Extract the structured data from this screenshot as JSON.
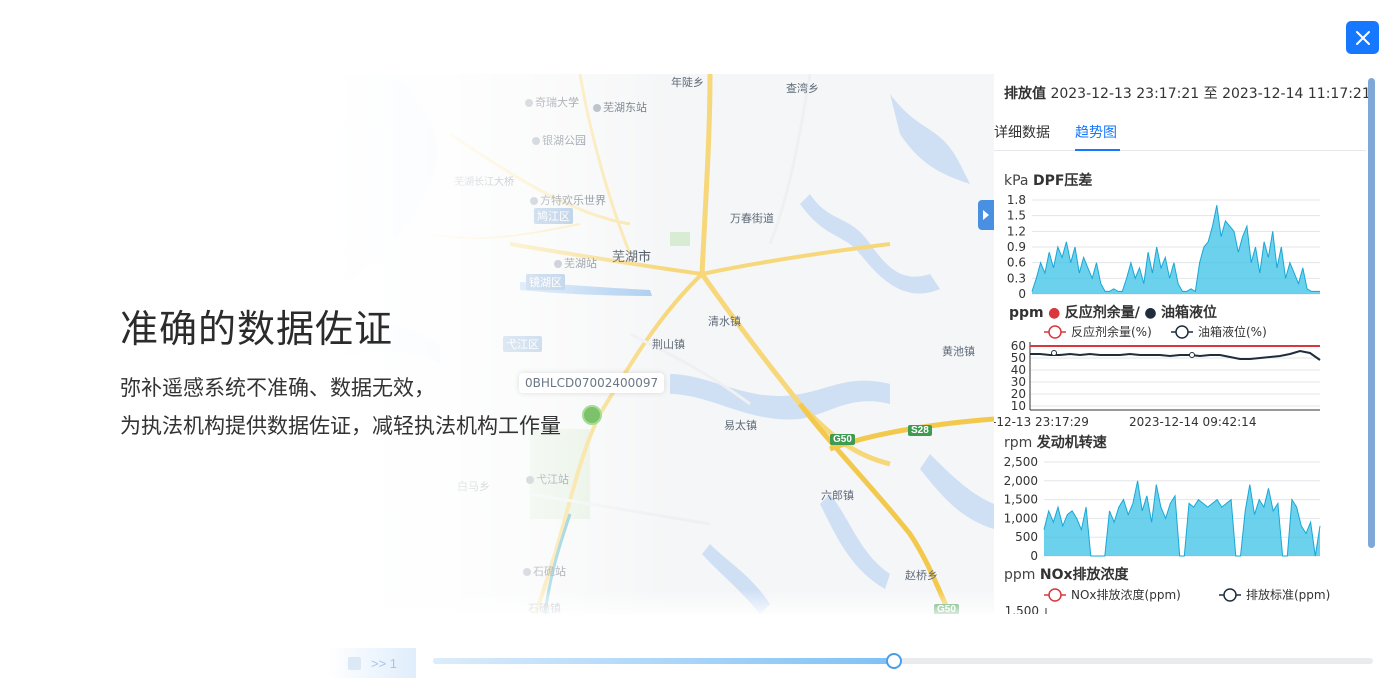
{
  "hero": {
    "title": "准确的数据佐证",
    "line1": "弥补遥感系统不准确、数据无效，",
    "line2": "为执法机构提供数据佐证，减轻执法机构工作量"
  },
  "map": {
    "vehicle_id": "0BHLCD07002400097",
    "labels": [
      {
        "text": "年陡乡",
        "cls": ""
      },
      {
        "text": "查湾乡",
        "cls": ""
      },
      {
        "text": "奇瑞大学",
        "cls": "poi"
      },
      {
        "text": "芜湖东站",
        "cls": "poi"
      },
      {
        "text": "银湖公园",
        "cls": "poi"
      },
      {
        "text": "芜湖长江大桥",
        "cls": ""
      },
      {
        "text": "方特欢乐世界",
        "cls": "poi"
      },
      {
        "text": "万春街道",
        "cls": ""
      },
      {
        "text": "芜湖市",
        "cls": "big"
      },
      {
        "text": "芜湖站",
        "cls": "poi"
      },
      {
        "text": "清水镇",
        "cls": ""
      },
      {
        "text": "荆山镇",
        "cls": ""
      },
      {
        "text": "黄池镇",
        "cls": ""
      },
      {
        "text": "易太镇",
        "cls": ""
      },
      {
        "text": "白马乡",
        "cls": ""
      },
      {
        "text": "弋江站",
        "cls": "poi"
      },
      {
        "text": "六郎镇",
        "cls": ""
      },
      {
        "text": "石硊站",
        "cls": "poi"
      },
      {
        "text": "石硊镇",
        "cls": ""
      },
      {
        "text": "赵桥乡",
        "cls": ""
      }
    ],
    "districts": [
      "鸠江区",
      "镜湖区",
      "弋江区"
    ],
    "roads": [
      "G50",
      "S28",
      "G50"
    ]
  },
  "panel": {
    "head_label": "排放值",
    "head_range_start": "2023-12-13 23:17:21",
    "head_range_sep": "至",
    "head_range_end": "2023-12-14 11:17:21",
    "tabs": [
      "详细数据",
      "趋势图"
    ]
  },
  "chart_data": [
    {
      "type": "area",
      "unit": "kPa",
      "title": "DPF压差",
      "ylim": [
        0,
        1.8
      ],
      "yticks": [
        "1.8",
        "1.5",
        "1.2",
        "0.9",
        "0.6",
        "0.3",
        "0"
      ],
      "color": "#39c1e6",
      "values": [
        0.05,
        0.3,
        0.6,
        0.4,
        0.8,
        0.5,
        0.9,
        0.7,
        1.0,
        0.6,
        0.9,
        0.4,
        0.7,
        0.5,
        0.3,
        0.6,
        0.2,
        0.05,
        0.05,
        0.1,
        0.05,
        0.05,
        0.3,
        0.6,
        0.3,
        0.5,
        0.2,
        0.8,
        0.4,
        0.9,
        0.5,
        0.7,
        0.3,
        0.6,
        0.2,
        0.05,
        0.05,
        0.1,
        0.05,
        0.6,
        0.9,
        1.0,
        1.3,
        1.7,
        1.1,
        1.4,
        1.3,
        1.2,
        0.8,
        1.1,
        1.3,
        0.6,
        0.9,
        0.4,
        1.0,
        0.7,
        1.2,
        0.5,
        0.9,
        0.3,
        0.6,
        0.4,
        0.2,
        0.5,
        0.1,
        0.05,
        0.05,
        0.05
      ]
    },
    {
      "type": "line",
      "unit": "ppm",
      "title_a": "反应剂余量/",
      "title_b": "油箱液位",
      "legend": [
        "反应剂余量(%)",
        "油箱液位(%)"
      ],
      "ylim": [
        0,
        60
      ],
      "yticks": [
        "60",
        "50",
        "40",
        "30",
        "20",
        "10"
      ],
      "xticks": [
        "-12-13 23:17:29",
        "2023-12-14 09:42:14"
      ],
      "series": [
        {
          "name": "反应剂余量(%)",
          "color": "#d9363e",
          "values": [
            60,
            60,
            60,
            60,
            60,
            60,
            60,
            60,
            60,
            60,
            60,
            60,
            60,
            60,
            60,
            60,
            60,
            60,
            60,
            60,
            60,
            60,
            60,
            60,
            60,
            60,
            60,
            60,
            60,
            60
          ]
        },
        {
          "name": "油箱液位(%)",
          "color": "#1f2d3d",
          "values": [
            52,
            52,
            51,
            51,
            52,
            51,
            52,
            51,
            51,
            51,
            52,
            51,
            51,
            51,
            50,
            51,
            51,
            50,
            51,
            51,
            49,
            47,
            47,
            48,
            49,
            50,
            52,
            55,
            53,
            46
          ]
        }
      ]
    },
    {
      "type": "area",
      "unit": "rpm",
      "title": "发动机转速",
      "ylim": [
        0,
        2500
      ],
      "yticks": [
        "2,500",
        "2,000",
        "1,500",
        "1,000",
        "500",
        "0"
      ],
      "color": "#39c1e6",
      "values": [
        700,
        1200,
        900,
        1300,
        800,
        1100,
        1200,
        1000,
        700,
        1300,
        0,
        0,
        0,
        0,
        1200,
        900,
        1300,
        1500,
        1100,
        1400,
        2000,
        1200,
        1600,
        900,
        1900,
        1300,
        1000,
        1400,
        1600,
        0,
        0,
        1400,
        1300,
        1500,
        1400,
        1300,
        1400,
        1500,
        1300,
        1400,
        1500,
        0,
        0,
        1200,
        1900,
        1100,
        1500,
        1300,
        1800,
        1200,
        1400,
        0,
        0,
        1500,
        1300,
        800,
        600,
        900,
        0,
        800
      ]
    },
    {
      "type": "line",
      "unit": "ppm",
      "title": "NOx排放浓度",
      "legend": [
        "NOx排放浓度(ppm)",
        "排放标准(ppm)"
      ],
      "yticks": [
        "1,500"
      ],
      "series": [
        {
          "name": "NOx排放浓度(ppm)",
          "color": "#d9363e"
        },
        {
          "name": "排放标准(ppm)",
          "color": "#1f2d3d"
        }
      ]
    }
  ],
  "playback": {
    "speed_label": ">> 1",
    "progress": 0.49
  }
}
